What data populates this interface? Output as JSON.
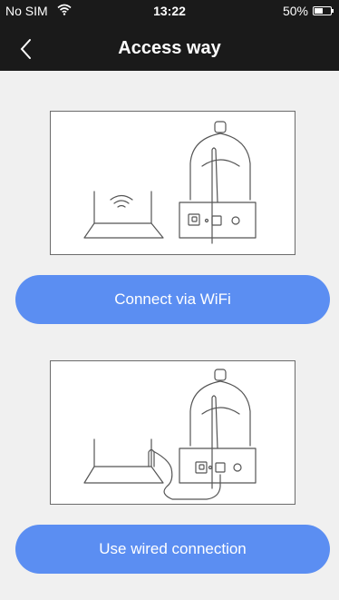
{
  "status_bar": {
    "carrier": "No SIM",
    "time": "13:22",
    "battery": "50%",
    "battery_level": 0.5
  },
  "nav": {
    "title": "Access way"
  },
  "options": {
    "wifi_label": "Connect via WiFi",
    "wired_label": "Use wired connection"
  },
  "colors": {
    "nav_bg": "#1a1a1a",
    "page_bg": "#f0f0f0",
    "button": "#5b8ef2"
  }
}
